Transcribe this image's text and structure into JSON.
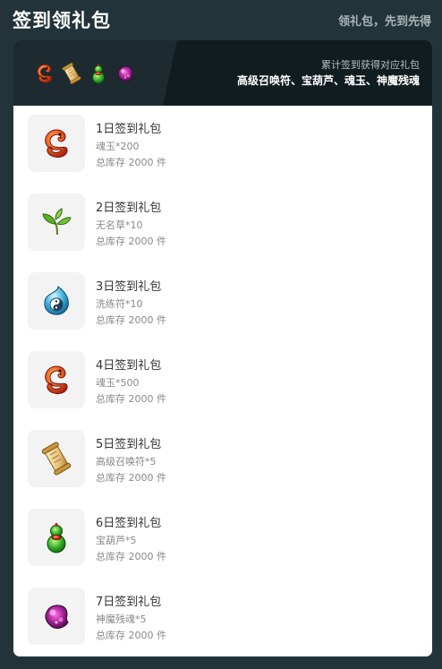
{
  "header": {
    "title": "签到领礼包",
    "subtitle": "领礼包，先到先得"
  },
  "banner": {
    "line1": "累计签到获得对应礼包",
    "line2": "高级召唤符、宝葫芦、魂玉、神魔残魂",
    "icons": [
      "soul-jade-icon",
      "scroll-icon",
      "gourd-icon",
      "demon-soul-icon"
    ]
  },
  "items": [
    {
      "title": "1日签到礼包",
      "reward": "魂玉*200",
      "stock": "总库存 2000 件",
      "icon": "soul-jade-icon"
    },
    {
      "title": "2日签到礼包",
      "reward": "无名草*10",
      "stock": "总库存 2000 件",
      "icon": "herb-icon"
    },
    {
      "title": "3日签到礼包",
      "reward": "洗练符*10",
      "stock": "总库存 2000 件",
      "icon": "refine-talisman-icon"
    },
    {
      "title": "4日签到礼包",
      "reward": "魂玉*500",
      "stock": "总库存 2000 件",
      "icon": "soul-jade-icon"
    },
    {
      "title": "5日签到礼包",
      "reward": "高级召唤符*5",
      "stock": "总库存 2000 件",
      "icon": "scroll-icon"
    },
    {
      "title": "6日签到礼包",
      "reward": "宝葫芦*5",
      "stock": "总库存 2000 件",
      "icon": "gourd-icon"
    },
    {
      "title": "7日签到礼包",
      "reward": "神魔残魂*5",
      "stock": "总库存 2000 件",
      "icon": "demon-soul-icon"
    }
  ]
}
